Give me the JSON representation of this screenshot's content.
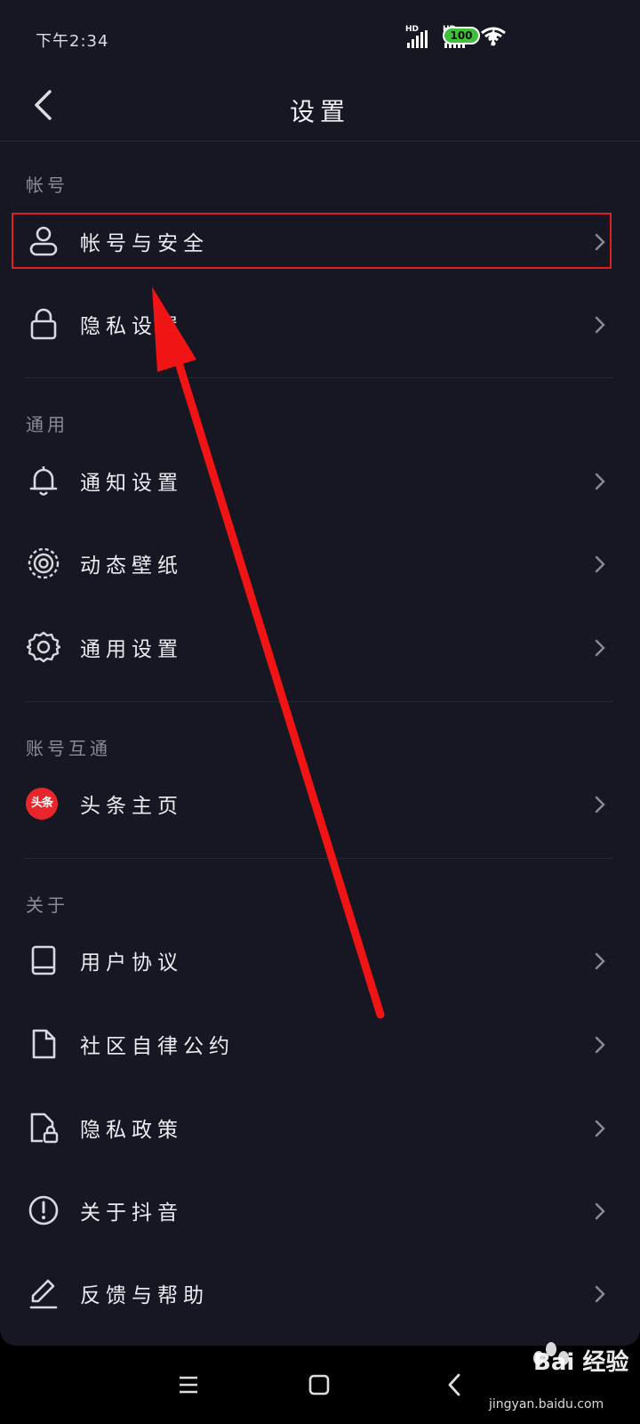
{
  "status_bar": {
    "time": "下午2:34",
    "signal1_label": "HD",
    "signal2_label": "HD",
    "battery": "100"
  },
  "header": {
    "title": "设置"
  },
  "sections": {
    "account": {
      "title": "帐号",
      "items": [
        {
          "label": "帐号与安全",
          "icon": "person-icon"
        },
        {
          "label": "隐私设置",
          "icon": "lock-icon"
        }
      ]
    },
    "general": {
      "title": "通用",
      "items": [
        {
          "label": "通知设置",
          "icon": "bell-icon"
        },
        {
          "label": "动态壁纸",
          "icon": "live-wallpaper-icon"
        },
        {
          "label": "通用设置",
          "icon": "gear-icon"
        }
      ]
    },
    "linked": {
      "title": "账号互通",
      "items": [
        {
          "label": "头条主页",
          "icon": "toutiao-logo",
          "logo_text": "头条"
        }
      ]
    },
    "about": {
      "title": "关于",
      "items": [
        {
          "label": "用户协议",
          "icon": "book-icon"
        },
        {
          "label": "社区自律公约",
          "icon": "document-icon"
        },
        {
          "label": "隐私政策",
          "icon": "privacy-document-icon"
        },
        {
          "label": "关于抖音",
          "icon": "info-icon"
        },
        {
          "label": "反馈与帮助",
          "icon": "pen-icon"
        }
      ]
    }
  },
  "annotation": {
    "highlight_color": "#e02020",
    "arrow_color": "#f01414"
  },
  "watermark": {
    "text": "Bai 经验",
    "sub": "jingyan.baidu.com"
  },
  "colors": {
    "background": "#161722",
    "text": "#ececf0",
    "section_text": "#8a8b96",
    "divider": "#262836"
  }
}
